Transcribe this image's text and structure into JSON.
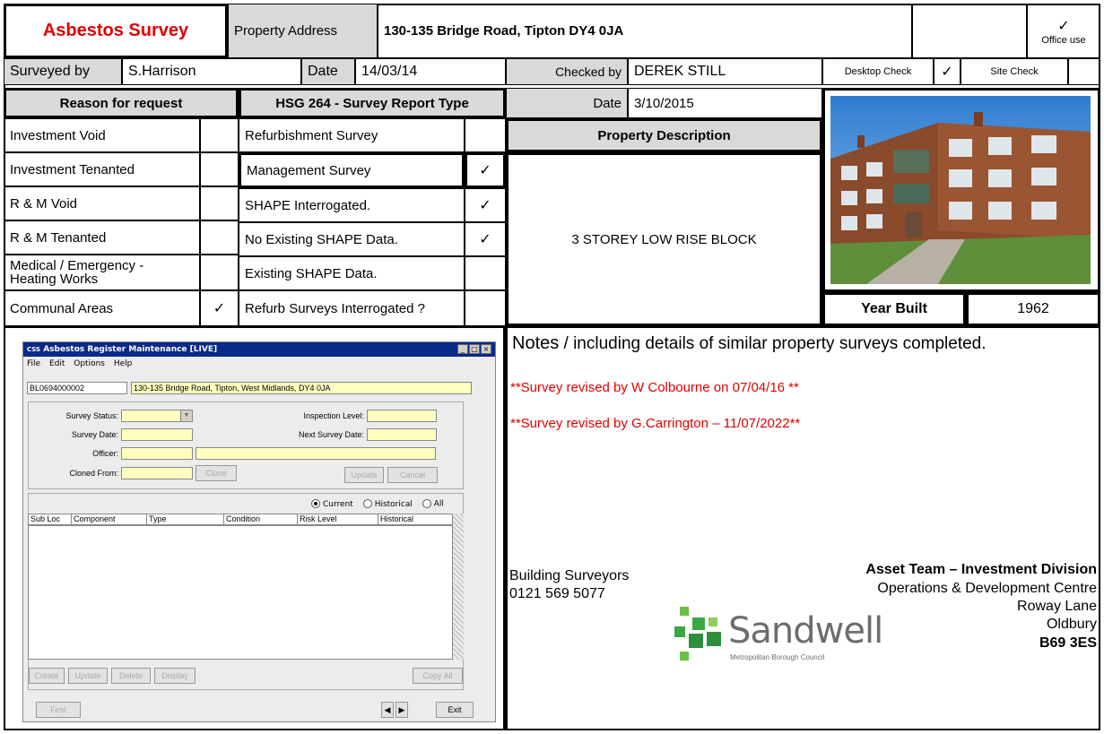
{
  "header": {
    "title": "Asbestos Survey",
    "property_address_label": "Property Address",
    "property_address": "130-135 Bridge Road, Tipton  DY4 0JA",
    "office_use_tick": "✓",
    "office_use_label": "Office use"
  },
  "survey": {
    "surveyed_by_label": "Surveyed by",
    "surveyed_by": "S.Harrison",
    "date_label": "Date",
    "date": "14/03/14",
    "checked_by_label": "Checked by",
    "checked_by": "DEREK STILL",
    "desktop_check_label": "Desktop Check",
    "desktop_check_tick": "✓",
    "site_check_label": "Site Check",
    "check_date_label": "Date",
    "check_date": "3/10/2015"
  },
  "reason": {
    "heading": "Reason for request",
    "items": [
      {
        "label": "Investment Void",
        "tick": ""
      },
      {
        "label": "Investment Tenanted",
        "tick": ""
      },
      {
        "label": "R & M Void",
        "tick": ""
      },
      {
        "label": "R & M Tenanted",
        "tick": ""
      },
      {
        "label": "Medical / Emergency -\nHeating Works",
        "tick": ""
      },
      {
        "label": "Communal Areas",
        "tick": "✓"
      }
    ]
  },
  "report_type": {
    "heading": "HSG 264 - Survey Report Type",
    "items": [
      {
        "label": "Refurbishment Survey",
        "tick": ""
      },
      {
        "label": "Management Survey",
        "tick": "✓"
      },
      {
        "label": "SHAPE Interrogated.",
        "tick": "✓"
      },
      {
        "label": "No Existing SHAPE Data.",
        "tick": "✓"
      },
      {
        "label": "Existing SHAPE Data.",
        "tick": ""
      },
      {
        "label": "Refurb Surveys Interrogated ?",
        "tick": ""
      }
    ]
  },
  "property": {
    "description_heading": "Property Description",
    "description": "3 STOREY LOW RISE BLOCK",
    "year_built_label": "Year Built",
    "year_built": "1962"
  },
  "notes": {
    "heading_main": "Notes",
    "heading_rest": " / including details of similar property surveys completed.",
    "lines": [
      "**Survey revised by W Colbourne on 07/04/16 **",
      "**Survey revised by G.Carrington – 11/07/2022**"
    ]
  },
  "footer": {
    "dept": "Building Surveyors",
    "phone": "0121 569 5077",
    "team": "Asset Team – Investment Division",
    "address": [
      "Operations & Development Centre",
      "Roway Lane",
      "Oldbury",
      "B69 3ES"
    ],
    "logo_name": "Sandwell",
    "logo_sub": "Metropolitan Borough Council"
  },
  "register_window": {
    "title": "Asbestos Register Maintenance [LIVE]",
    "title_prefix": "CSS",
    "menu": [
      "File",
      "Edit",
      "Options",
      "Help"
    ],
    "ref": "BL0694000002",
    "address": "130-135 Bridge Road, Tipton, West Midlands, DY4 0JA",
    "labels": {
      "survey_status": "Survey Status:",
      "survey_date": "Survey Date:",
      "officer": "Officer:",
      "cloned_from": "Cloned From:",
      "inspection_level": "Inspection Level:",
      "next_survey_date": "Next Survey Date:"
    },
    "buttons": {
      "clone": "Clone",
      "update": "Update",
      "cancel": "Cancel",
      "create": "Create",
      "update2": "Update",
      "delete": "Delete",
      "display": "Display",
      "copy_all": "Copy All",
      "first": "First",
      "exit": "Exit"
    },
    "radios": [
      "Current",
      "Historical",
      "All"
    ],
    "columns": [
      "Sub Loc",
      "Component",
      "Type",
      "Condition",
      "Risk Level",
      "Historical"
    ]
  }
}
